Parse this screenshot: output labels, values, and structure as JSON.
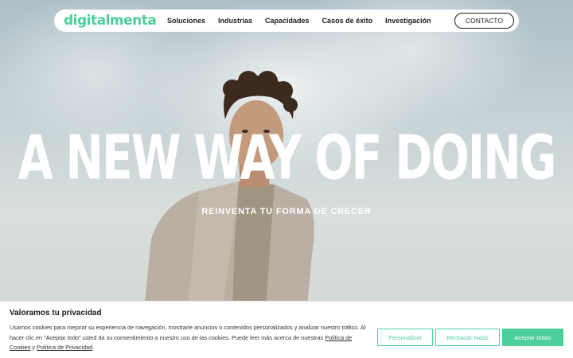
{
  "brand": {
    "logo_text": "digitalmenta",
    "accent_color": "#4ccf98"
  },
  "nav": {
    "items": [
      {
        "label": "Soluciones"
      },
      {
        "label": "Industrias"
      },
      {
        "label": "Capacidades"
      },
      {
        "label": "Casos de éxito"
      },
      {
        "label": "Investigación"
      }
    ],
    "contact_label": "CONTACTO"
  },
  "hero": {
    "headline": "A NEW WAY OF DOING",
    "subheadline": "REINVENTA TU FORMA DE CRECER"
  },
  "cookie_banner": {
    "title": "Valoramos tu privacidad",
    "text_part1": "Usamos cookies para mejorar su experiencia de navegación, mostrarle anuncios o contenidos personalizados y analizar nuestro tráfico. Al hacer clic en \"Aceptar todo\" usted da su consentimiento a nuestro uso de las cookies. Puede leer más acerca de nuestras ",
    "link_cookies": "Política de Cookies",
    "text_part2": " y ",
    "link_privacy": "Política de Privacidad",
    "text_part3": ".",
    "buttons": {
      "customize": "Personalizar",
      "reject": "Rechazar todas",
      "accept": "Aceptar todas"
    }
  }
}
